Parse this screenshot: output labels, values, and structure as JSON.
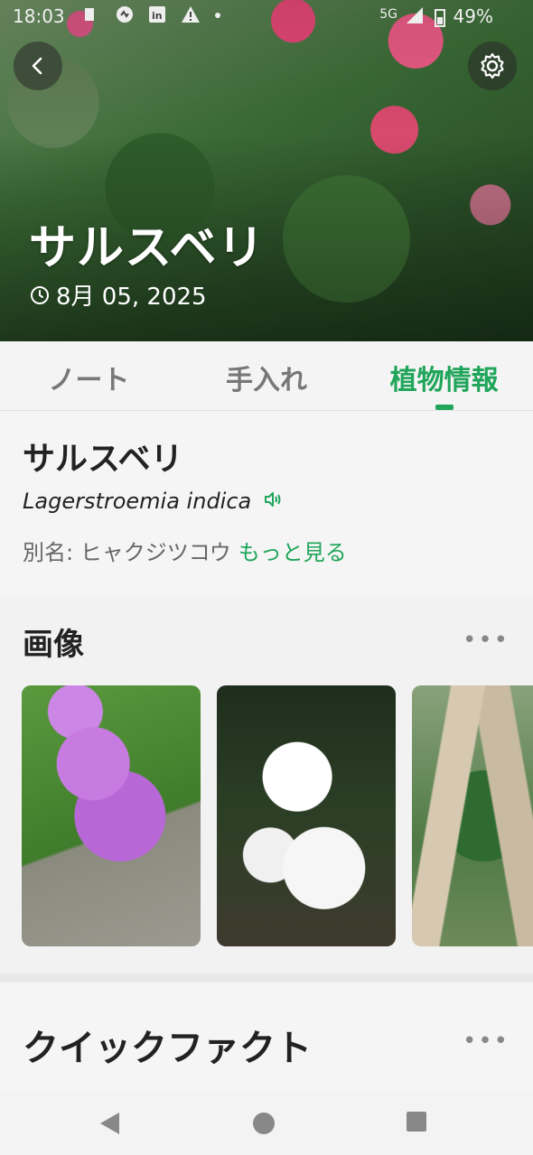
{
  "status_bar": {
    "time": "18:03",
    "network": "5G",
    "battery": "49%"
  },
  "header": {
    "title": "サルスベリ",
    "date": "8月 05, 2025"
  },
  "tabs": [
    {
      "label": "ノート",
      "active": false
    },
    {
      "label": "手入れ",
      "active": false
    },
    {
      "label": "植物情報",
      "active": true
    }
  ],
  "plant_info": {
    "name": "サルスベリ",
    "scientific_name": "Lagerstroemia indica",
    "alias_label": "別名: ヒャクジツコウ",
    "more_link": "もっと見る"
  },
  "images_section": {
    "title": "画像",
    "menu": "•••"
  },
  "facts_section": {
    "title": "クイックファクト",
    "menu": "•••"
  },
  "colors": {
    "accent": "#20a55a"
  }
}
